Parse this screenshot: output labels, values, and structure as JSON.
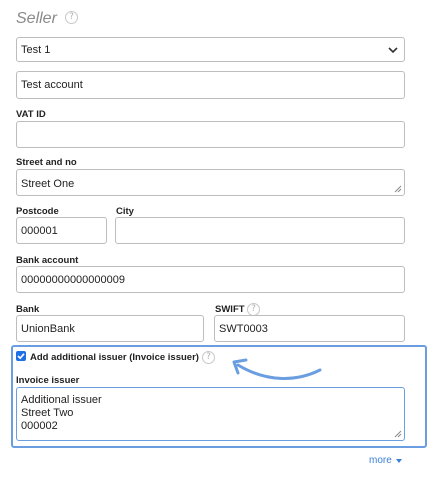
{
  "seller": {
    "title": "Seller",
    "help_symbol": "?",
    "account_select": {
      "value": "Test 1"
    },
    "account_name": {
      "value": "Test account"
    },
    "vat_id": {
      "label": "VAT ID",
      "value": ""
    },
    "street": {
      "label": "Street and no",
      "value": "Street One"
    },
    "postcode": {
      "label": "Postcode",
      "value": "000001"
    },
    "city": {
      "label": "City",
      "value": ""
    },
    "bank_account": {
      "label": "Bank account",
      "value": "00000000000000009"
    },
    "bank": {
      "label": "Bank",
      "value": "UnionBank"
    },
    "swift": {
      "label": "SWIFT",
      "value": "SWT0003"
    }
  },
  "additional_issuer": {
    "checkbox_label": "Add additional issuer (Invoice issuer)",
    "checked": true,
    "invoice_issuer_label": "Invoice issuer",
    "invoice_issuer_lines": [
      "Additional issuer",
      "Street Two",
      "000002"
    ]
  },
  "footer": {
    "more_label": "more"
  },
  "colors": {
    "highlight": "#6a9ee0",
    "accent": "#1f6fe5",
    "link": "#3a7fd8"
  }
}
